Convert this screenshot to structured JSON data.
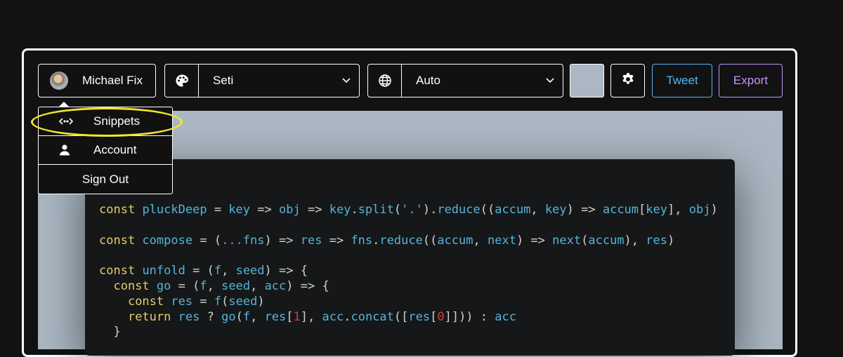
{
  "user": {
    "name": "Michael Fix"
  },
  "theme": {
    "selected": "Seti"
  },
  "language": {
    "selected": "Auto"
  },
  "background": {
    "color": "#abb8c3"
  },
  "actions": {
    "tweet": "Tweet",
    "export": "Export"
  },
  "menu": {
    "items": [
      {
        "label": "Snippets",
        "icon": "code-brackets-icon"
      },
      {
        "label": "Account",
        "icon": "user-icon"
      },
      {
        "label": "Sign Out"
      }
    ]
  },
  "code": {
    "lines": [
      "const pluckDeep = key => obj => key.split('.').reduce((accum, key) => accum[key], obj)",
      "",
      "const compose = (...fns) => res => fns.reduce((accum, next) => next(accum), res)",
      "",
      "const unfold = (f, seed) => {",
      "  const go = (f, seed, acc) => {",
      "    const res = f(seed)",
      "    return res ? go(f, res[1], acc.concat([res[0]])) : acc",
      "  }"
    ]
  },
  "colors": {
    "tweet": "#57b5f9",
    "export": "#c198fb",
    "highlight": "#f5e52f",
    "editor_bg": "#151718"
  }
}
